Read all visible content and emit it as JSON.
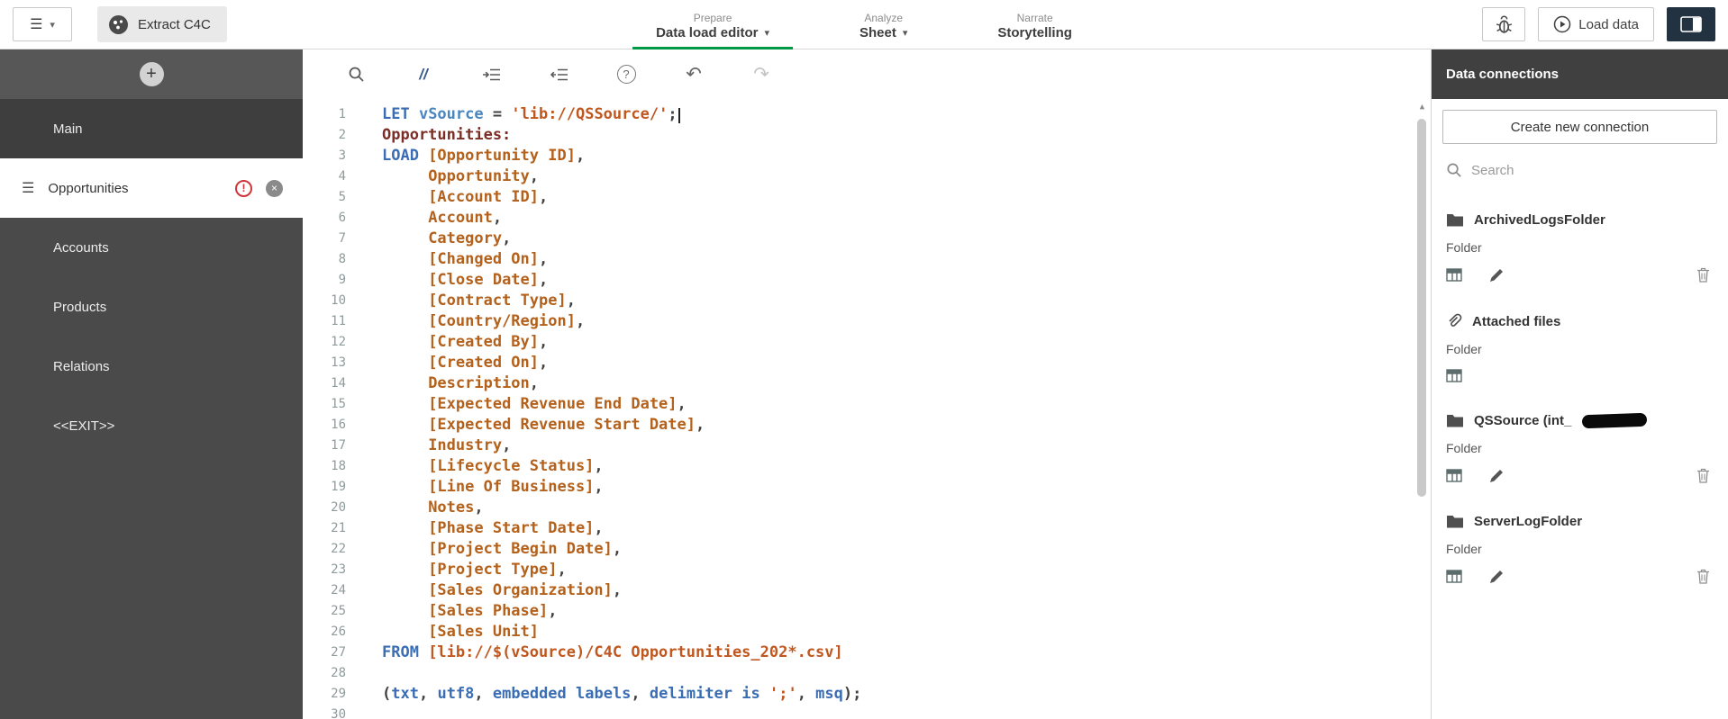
{
  "topbar": {
    "app_label": "Extract C4C",
    "nav": [
      {
        "group": "Prepare",
        "label": "Data load editor"
      },
      {
        "group": "Analyze",
        "label": "Sheet"
      },
      {
        "group": "Narrate",
        "label": "Storytelling"
      }
    ],
    "load_data_label": "Load data",
    "accent_green": "#009845"
  },
  "sidebar": {
    "sections": [
      {
        "label": "Main"
      },
      {
        "label": "Opportunities",
        "selected": true,
        "warning": true
      },
      {
        "label": "Accounts"
      },
      {
        "label": "Products"
      },
      {
        "label": "Relations"
      },
      {
        "label": "<<EXIT>>"
      }
    ]
  },
  "toolbar_icons": [
    "search-icon",
    "comment-icon",
    "indent-icon",
    "outdent-icon",
    "help-icon",
    "undo-icon",
    "redo-icon"
  ],
  "editor": {
    "syntax_colors": {
      "keyword": "#3a6db4",
      "string": "#c0571e",
      "field": "#b4611c",
      "table_label": "#7b2d26"
    },
    "lines": [
      [
        [
          "kw",
          "LET "
        ],
        [
          "var",
          "vSource"
        ],
        [
          "pl",
          " = "
        ],
        [
          "str",
          "'lib://QSSource/'"
        ],
        [
          "pl",
          ";"
        ],
        [
          "caret",
          ""
        ]
      ],
      [
        [
          "tbl",
          "Opportunities:"
        ]
      ],
      [
        [
          "kw",
          "LOAD "
        ],
        [
          "fld",
          "[Opportunity ID]"
        ],
        [
          "pl",
          ","
        ]
      ],
      [
        [
          "pl",
          "     "
        ],
        [
          "fld",
          "Opportunity"
        ],
        [
          "pl",
          ","
        ]
      ],
      [
        [
          "pl",
          "     "
        ],
        [
          "fld",
          "[Account ID]"
        ],
        [
          "pl",
          ","
        ]
      ],
      [
        [
          "pl",
          "     "
        ],
        [
          "fld",
          "Account"
        ],
        [
          "pl",
          ","
        ]
      ],
      [
        [
          "pl",
          "     "
        ],
        [
          "fld",
          "Category"
        ],
        [
          "pl",
          ","
        ]
      ],
      [
        [
          "pl",
          "     "
        ],
        [
          "fld",
          "[Changed On]"
        ],
        [
          "pl",
          ","
        ]
      ],
      [
        [
          "pl",
          "     "
        ],
        [
          "fld",
          "[Close Date]"
        ],
        [
          "pl",
          ","
        ]
      ],
      [
        [
          "pl",
          "     "
        ],
        [
          "fld",
          "[Contract Type]"
        ],
        [
          "pl",
          ","
        ]
      ],
      [
        [
          "pl",
          "     "
        ],
        [
          "fld",
          "[Country/Region]"
        ],
        [
          "pl",
          ","
        ]
      ],
      [
        [
          "pl",
          "     "
        ],
        [
          "fld",
          "[Created By]"
        ],
        [
          "pl",
          ","
        ]
      ],
      [
        [
          "pl",
          "     "
        ],
        [
          "fld",
          "[Created On]"
        ],
        [
          "pl",
          ","
        ]
      ],
      [
        [
          "pl",
          "     "
        ],
        [
          "fld",
          "Description"
        ],
        [
          "pl",
          ","
        ]
      ],
      [
        [
          "pl",
          "     "
        ],
        [
          "fld",
          "[Expected Revenue End Date]"
        ],
        [
          "pl",
          ","
        ]
      ],
      [
        [
          "pl",
          "     "
        ],
        [
          "fld",
          "[Expected Revenue Start Date]"
        ],
        [
          "pl",
          ","
        ]
      ],
      [
        [
          "pl",
          "     "
        ],
        [
          "fld",
          "Industry"
        ],
        [
          "pl",
          ","
        ]
      ],
      [
        [
          "pl",
          "     "
        ],
        [
          "fld",
          "[Lifecycle Status]"
        ],
        [
          "pl",
          ","
        ]
      ],
      [
        [
          "pl",
          "     "
        ],
        [
          "fld",
          "[Line Of Business]"
        ],
        [
          "pl",
          ","
        ]
      ],
      [
        [
          "pl",
          "     "
        ],
        [
          "fld",
          "Notes"
        ],
        [
          "pl",
          ","
        ]
      ],
      [
        [
          "pl",
          "     "
        ],
        [
          "fld",
          "[Phase Start Date]"
        ],
        [
          "pl",
          ","
        ]
      ],
      [
        [
          "pl",
          "     "
        ],
        [
          "fld",
          "[Project Begin Date]"
        ],
        [
          "pl",
          ","
        ]
      ],
      [
        [
          "pl",
          "     "
        ],
        [
          "fld",
          "[Project Type]"
        ],
        [
          "pl",
          ","
        ]
      ],
      [
        [
          "pl",
          "     "
        ],
        [
          "fld",
          "[Sales Organization]"
        ],
        [
          "pl",
          ","
        ]
      ],
      [
        [
          "pl",
          "     "
        ],
        [
          "fld",
          "[Sales Phase]"
        ],
        [
          "pl",
          ","
        ]
      ],
      [
        [
          "pl",
          "     "
        ],
        [
          "fld",
          "[Sales Unit]"
        ]
      ],
      [
        [
          "kw",
          "FROM "
        ],
        [
          "str",
          "[lib://$(vSource)/C4C Opportunities_202*.csv]"
        ]
      ],
      [],
      [
        [
          "pl",
          "("
        ],
        [
          "kw",
          "txt"
        ],
        [
          "pl",
          ", "
        ],
        [
          "kw",
          "utf8"
        ],
        [
          "pl",
          ", "
        ],
        [
          "kw",
          "embedded labels"
        ],
        [
          "pl",
          ", "
        ],
        [
          "kw",
          "delimiter is "
        ],
        [
          "str",
          "';'"
        ],
        [
          "pl",
          ", "
        ],
        [
          "kw",
          "msq"
        ],
        [
          "pl",
          ");"
        ]
      ],
      []
    ]
  },
  "connections": {
    "title": "Data connections",
    "create_button": "Create new connection",
    "search_placeholder": "Search",
    "items": [
      {
        "name": "ArchivedLogsFolder",
        "type": "Folder",
        "icon": "folder",
        "redacted": false,
        "actions": {
          "select": true,
          "edit": true,
          "delete": true
        }
      },
      {
        "name": "Attached files",
        "type": "Folder",
        "icon": "paperclip",
        "redacted": false,
        "actions": {
          "select": true,
          "edit": false,
          "delete": false
        }
      },
      {
        "name": "QSSource (int_",
        "type": "Folder",
        "icon": "folder",
        "redacted": true,
        "actions": {
          "select": true,
          "edit": true,
          "delete": true
        }
      },
      {
        "name": "ServerLogFolder",
        "type": "Folder",
        "icon": "folder",
        "redacted": false,
        "actions": {
          "select": true,
          "edit": true,
          "delete": true
        }
      }
    ]
  }
}
